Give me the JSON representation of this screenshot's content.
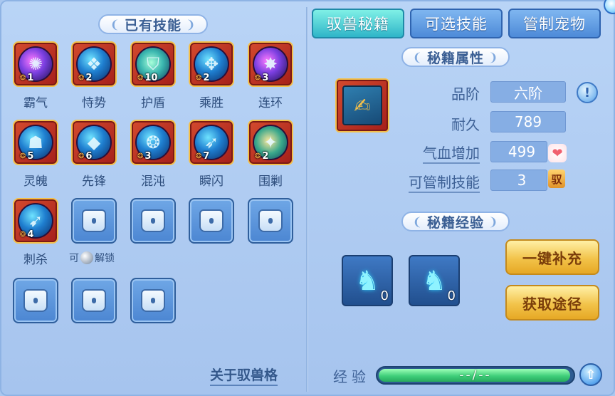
{
  "left": {
    "title": "已有技能",
    "skills": [
      {
        "name": "霸气",
        "level": "1",
        "glyph": "✺",
        "tone": "purple"
      },
      {
        "name": "恃势",
        "level": "2",
        "glyph": "❖",
        "tone": "blue"
      },
      {
        "name": "护盾",
        "level": "10",
        "glyph": "⛉",
        "tone": "green"
      },
      {
        "name": "乘胜",
        "level": "2",
        "glyph": "✥",
        "tone": "blue"
      },
      {
        "name": "连环",
        "level": "3",
        "glyph": "✸",
        "tone": "purple"
      },
      {
        "name": "灵魄",
        "level": "5",
        "glyph": "☗",
        "tone": "blue"
      },
      {
        "name": "先锋",
        "level": "6",
        "glyph": "◆",
        "tone": "blue"
      },
      {
        "name": "混沌",
        "level": "3",
        "glyph": "❂",
        "tone": "blue"
      },
      {
        "name": "瞬闪",
        "level": "7",
        "glyph": "➶",
        "tone": "blue"
      },
      {
        "name": "围剿",
        "level": "2",
        "glyph": "✦",
        "tone": "gold"
      },
      {
        "name": "刺杀",
        "level": "4",
        "glyph": "➹",
        "tone": "blue"
      }
    ],
    "unlock_label_pre": "可",
    "unlock_label_post": "解锁",
    "about_link": "关于驭兽格"
  },
  "tabs": [
    {
      "label": "驭兽秘籍",
      "active": true
    },
    {
      "label": "可选技能",
      "active": false
    },
    {
      "label": "管制宠物",
      "active": false
    }
  ],
  "attributes": {
    "title": "秘籍属性",
    "rank_label": "品阶",
    "rank_value": "六阶",
    "durability_label": "耐久",
    "durability_value": "789",
    "hp_label": "气血增加",
    "hp_value": "499",
    "controllable_label": "可管制技能",
    "controllable_value": "3",
    "controllable_badge": "驭",
    "info_icon": "!"
  },
  "experience": {
    "title": "秘籍经验",
    "items": [
      {
        "count": "0"
      },
      {
        "count": "0"
      }
    ],
    "refill_button": "一键补充",
    "obtain_button": "获取途径",
    "exp_label": "经验",
    "exp_text": "--/--",
    "exp_fill_fraction": 0.99
  },
  "colors": {
    "accent": "#2fb5c8",
    "gold": "#f2c34a",
    "panel": "#a9c7ef"
  }
}
